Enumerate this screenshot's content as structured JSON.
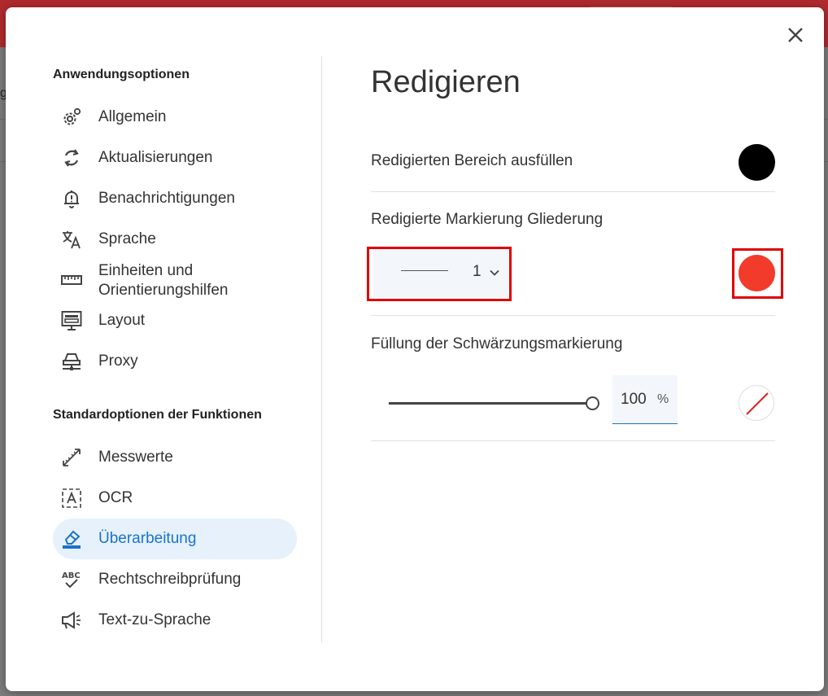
{
  "background_app": {
    "letter": "g"
  },
  "sidebar": {
    "section1_title": "Anwendungsoptionen",
    "section1_items": [
      {
        "label": "Allgemein",
        "icon": "gear-icon"
      },
      {
        "label": "Aktualisierungen",
        "icon": "refresh-icon"
      },
      {
        "label": "Benachrichtigungen",
        "icon": "bell-icon"
      },
      {
        "label": "Sprache",
        "icon": "translate-icon"
      },
      {
        "label": "Einheiten und Orientierungshilfen",
        "icon": "ruler-icon"
      },
      {
        "label": "Layout",
        "icon": "layout-icon"
      },
      {
        "label": "Proxy",
        "icon": "proxy-icon"
      }
    ],
    "section2_title": "Standardoptionen der Funktionen",
    "section2_items": [
      {
        "label": "Messwerte",
        "icon": "measure-icon"
      },
      {
        "label": "OCR",
        "icon": "ocr-icon"
      },
      {
        "label": "Überarbeitung",
        "icon": "highlighter-icon",
        "active": true
      },
      {
        "label": "Rechtschreibprüfung",
        "icon": "spellcheck-icon"
      },
      {
        "label": "Text-zu-Sprache",
        "icon": "megaphone-icon"
      }
    ]
  },
  "panel": {
    "title": "Redigieren",
    "fill_label": "Redigierten Bereich ausfüllen",
    "fill_color": "#000000",
    "outline_label": "Redigierte Markierung Gliederung",
    "outline_width": "1",
    "outline_color": "#f23b2a",
    "blackout_label": "Füllung der Schwärzungsmarkierung",
    "opacity_value": "100",
    "opacity_unit": "%",
    "opacity_fraction": 1.0,
    "blackout_color": "none"
  },
  "colors": {
    "accent": "#1a73c9",
    "active_bg": "#e6f1fc",
    "highlight_box": "#e00000",
    "app_header": "#b02a2e"
  }
}
